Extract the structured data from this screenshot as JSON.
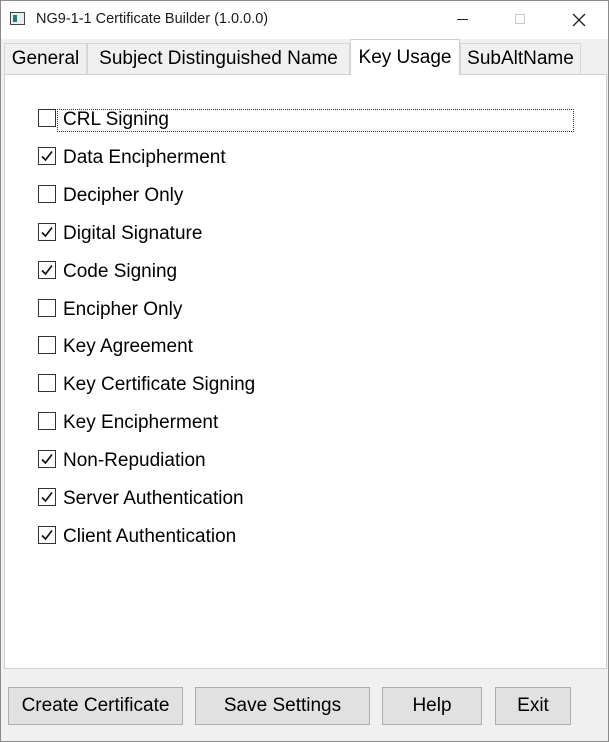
{
  "window": {
    "title": "NG9-1-1 Certificate Builder (1.0.0.0)",
    "controls": {
      "minimize_icon": "minimize-icon",
      "maximize_icon": "maximize-icon",
      "close_icon": "close-icon"
    }
  },
  "tabs": [
    {
      "label": "General",
      "active": false
    },
    {
      "label": "Subject Distinguished Name",
      "active": false
    },
    {
      "label": "Key Usage",
      "active": true
    },
    {
      "label": "SubAltName",
      "active": false
    }
  ],
  "key_usage": [
    {
      "label": "CRL Signing",
      "checked": false
    },
    {
      "label": "Data Encipherment",
      "checked": true
    },
    {
      "label": "Decipher Only",
      "checked": false
    },
    {
      "label": "Digital Signature",
      "checked": true
    },
    {
      "label": "Code Signing",
      "checked": true
    },
    {
      "label": "Encipher Only",
      "checked": false
    },
    {
      "label": "Key Agreement",
      "checked": false
    },
    {
      "label": "Key Certificate Signing",
      "checked": false
    },
    {
      "label": "Key Encipherment",
      "checked": false
    },
    {
      "label": "Non-Repudiation",
      "checked": true
    },
    {
      "label": "Server Authentication",
      "checked": true
    },
    {
      "label": "Client Authentication",
      "checked": true
    }
  ],
  "buttons": {
    "create": "Create Certificate",
    "save": "Save Settings",
    "help": "Help",
    "exit": "Exit"
  },
  "colors": {
    "window_bg": "#f0f0f0",
    "button_bg": "#e1e1e1",
    "button_border": "#adadad"
  }
}
